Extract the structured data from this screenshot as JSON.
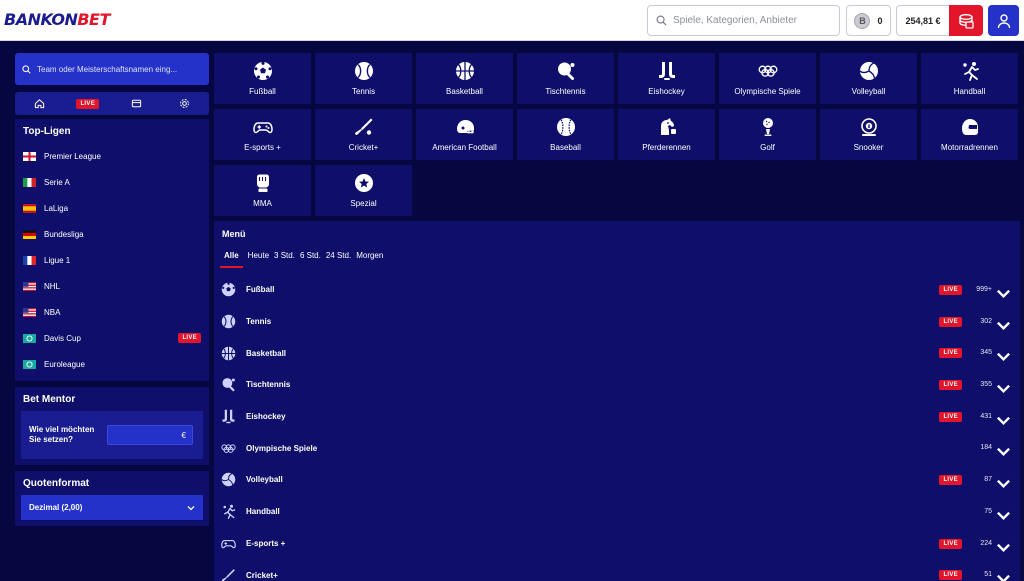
{
  "header": {
    "logo_bankon": "BANKON",
    "logo_bet": "BET",
    "search_placeholder": "Spiele, Kategorien, Anbieter",
    "coin_symbol": "B",
    "coin_count": "0",
    "balance": "254,81 €"
  },
  "sidebar": {
    "search_placeholder": "Team oder Meisterschaftsnamen eing...",
    "live_tab": "LIVE",
    "top_title": "Top-Ligen",
    "leagues": [
      {
        "name": "Premier League",
        "flag": "england"
      },
      {
        "name": "Serie A",
        "flag": "italy"
      },
      {
        "name": "LaLiga",
        "flag": "spain"
      },
      {
        "name": "Bundesliga",
        "flag": "germany"
      },
      {
        "name": "Ligue 1",
        "flag": "france"
      },
      {
        "name": "NHL",
        "flag": "usa"
      },
      {
        "name": "NBA",
        "flag": "usa"
      },
      {
        "name": "Davis Cup",
        "flag": "world",
        "live": "LIVE"
      },
      {
        "name": "Euroleague",
        "flag": "world"
      }
    ],
    "mentor_title": "Bet Mentor",
    "mentor_question": "Wie viel möchten Sie setzen?",
    "mentor_currency": "€",
    "quote_title": "Quotenformat",
    "quote_value": "Dezimal (2,00)"
  },
  "sports": [
    {
      "label": "Fußball",
      "icon": "soccer-ball-icon"
    },
    {
      "label": "Tennis",
      "icon": "tennis-ball-icon"
    },
    {
      "label": "Basketball",
      "icon": "basketball-icon"
    },
    {
      "label": "Tischtennis",
      "icon": "table-tennis-icon"
    },
    {
      "label": "Eishockey",
      "icon": "ice-hockey-icon"
    },
    {
      "label": "Olympische Spiele",
      "icon": "olympic-rings-icon"
    },
    {
      "label": "Volleyball",
      "icon": "volleyball-icon"
    },
    {
      "label": "Handball",
      "icon": "handball-icon"
    },
    {
      "label": "E-sports +",
      "icon": "gamepad-icon"
    },
    {
      "label": "Cricket+",
      "icon": "cricket-icon"
    },
    {
      "label": "American Football",
      "icon": "football-helmet-icon"
    },
    {
      "label": "Baseball",
      "icon": "baseball-icon"
    },
    {
      "label": "Pferderennen",
      "icon": "horse-racing-icon"
    },
    {
      "label": "Golf",
      "icon": "golf-icon"
    },
    {
      "label": "Snooker",
      "icon": "snooker-icon"
    },
    {
      "label": "Motorradrennen",
      "icon": "motorcycle-helmet-icon"
    },
    {
      "label": "MMA",
      "icon": "mma-glove-icon"
    },
    {
      "label": "Spezial",
      "icon": "star-icon"
    }
  ],
  "menu": {
    "title": "Menü",
    "filters": [
      "Alle",
      "Heute",
      "3 Std.",
      "6 Std.",
      "24 Std.",
      "Morgen"
    ],
    "rows": [
      {
        "name": "Fußball",
        "live": "LIVE",
        "count": "999+",
        "icon": "soccer-ball-icon"
      },
      {
        "name": "Tennis",
        "live": "LIVE",
        "count": "302",
        "icon": "tennis-ball-icon"
      },
      {
        "name": "Basketball",
        "live": "LIVE",
        "count": "345",
        "icon": "basketball-icon"
      },
      {
        "name": "Tischtennis",
        "live": "LIVE",
        "count": "355",
        "icon": "table-tennis-icon"
      },
      {
        "name": "Eishockey",
        "live": "LIVE",
        "count": "431",
        "icon": "ice-hockey-icon"
      },
      {
        "name": "Olympische Spiele",
        "live": "",
        "count": "184",
        "icon": "olympic-rings-icon"
      },
      {
        "name": "Volleyball",
        "live": "LIVE",
        "count": "87",
        "icon": "volleyball-icon"
      },
      {
        "name": "Handball",
        "live": "",
        "count": "75",
        "icon": "handball-icon"
      },
      {
        "name": "E-sports +",
        "live": "LIVE",
        "count": "224",
        "icon": "gamepad-icon"
      },
      {
        "name": "Cricket+",
        "live": "LIVE",
        "count": "51",
        "icon": "cricket-icon"
      }
    ]
  },
  "colors": {
    "brand_blue": "#1a1d8f",
    "brand_red": "#e3152b",
    "page_bg": "#060640",
    "panel_bg": "#0f0f6b",
    "accent_blue": "#2532c9"
  }
}
